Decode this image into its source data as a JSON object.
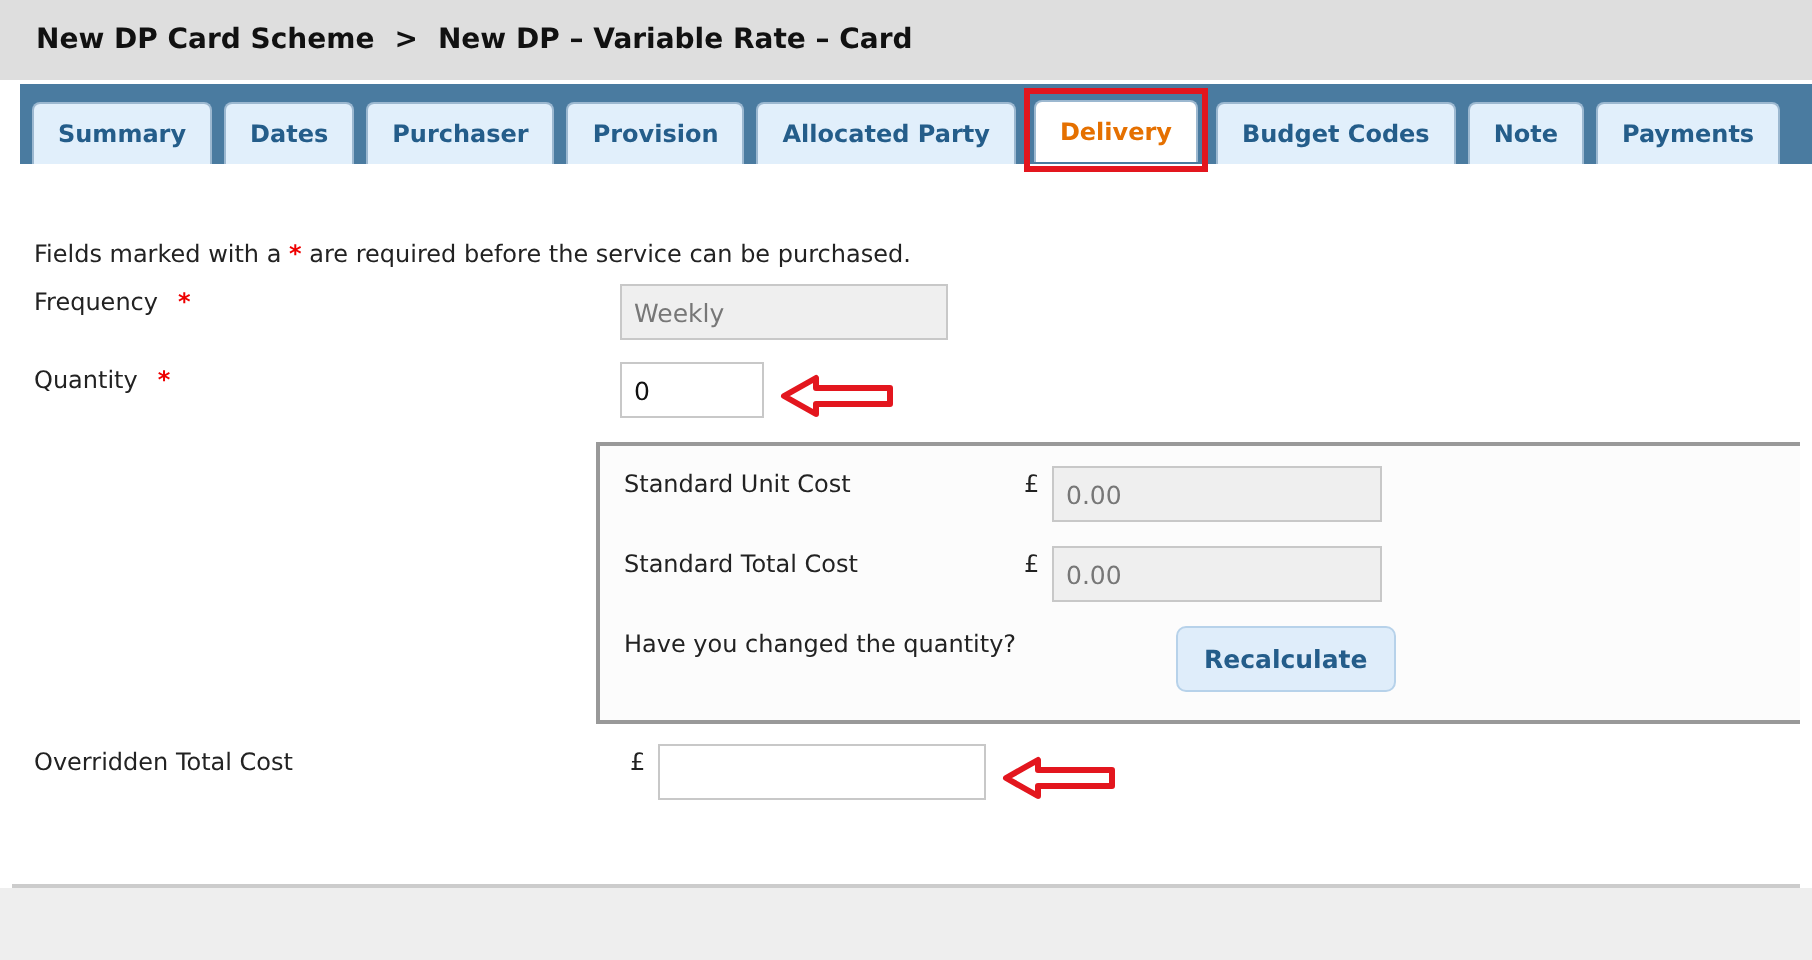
{
  "breadcrumb": {
    "parent": "New DP Card Scheme",
    "separator": ">",
    "current": "New DP – Variable Rate – Card"
  },
  "tabs": [
    {
      "label": "Summary",
      "selected": false,
      "highlighted": false
    },
    {
      "label": "Dates",
      "selected": false,
      "highlighted": false
    },
    {
      "label": "Purchaser",
      "selected": false,
      "highlighted": false
    },
    {
      "label": "Provision",
      "selected": false,
      "highlighted": false
    },
    {
      "label": "Allocated Party",
      "selected": false,
      "highlighted": false
    },
    {
      "label": "Delivery",
      "selected": true,
      "highlighted": true
    },
    {
      "label": "Budget Codes",
      "selected": false,
      "highlighted": false
    },
    {
      "label": "Note",
      "selected": false,
      "highlighted": false
    },
    {
      "label": "Payments",
      "selected": false,
      "highlighted": false
    }
  ],
  "required_note": {
    "before": "Fields marked with a",
    "mark": "*",
    "after": "are required before the service can be purchased."
  },
  "frequency": {
    "label": "Frequency",
    "required_mark": "*",
    "value": "Weekly",
    "disabled": true
  },
  "quantity": {
    "label": "Quantity",
    "required_mark": "*",
    "value": "0",
    "annotated": true
  },
  "cost_panel": {
    "unit_cost": {
      "label": "Standard Unit Cost",
      "currency": "£",
      "value": "0.00"
    },
    "total_cost": {
      "label": "Standard Total Cost",
      "currency": "£",
      "value": "0.00"
    },
    "question": "Have you changed the quantity?",
    "button": "Recalculate"
  },
  "overridden": {
    "label": "Overridden Total Cost",
    "currency": "£",
    "annotated": true
  }
}
